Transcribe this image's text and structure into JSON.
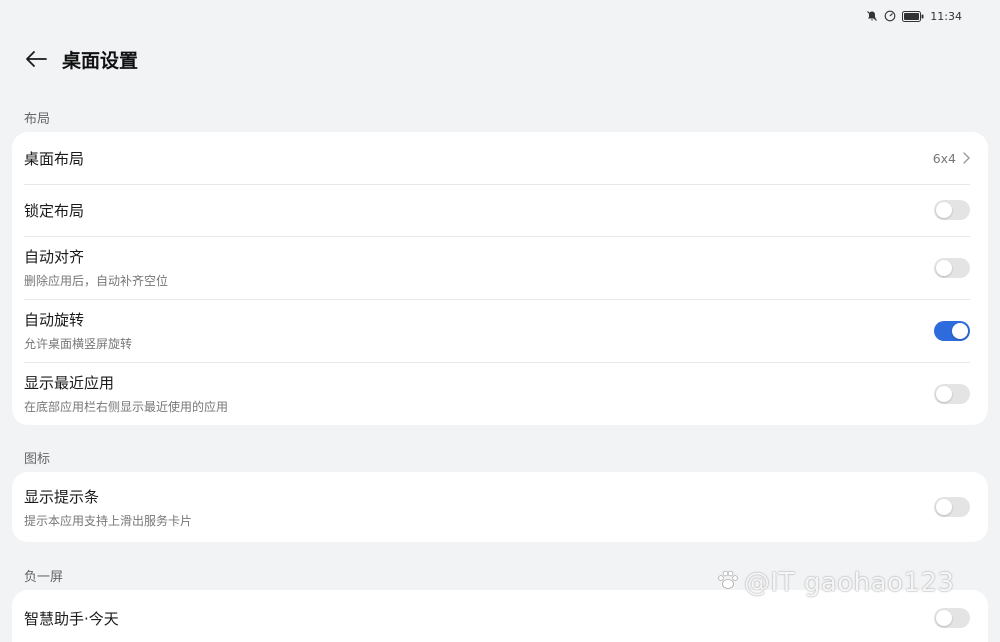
{
  "status_bar": {
    "time": "11:34",
    "icons": [
      "bell-muted-icon",
      "speed-icon",
      "battery-icon"
    ]
  },
  "header": {
    "back_icon": "arrow-left-icon",
    "title": "桌面设置"
  },
  "sections": {
    "layout": {
      "label": "布局",
      "items": {
        "desktop_layout": {
          "title": "桌面布局",
          "value": "6x4"
        },
        "lock_layout": {
          "title": "锁定布局",
          "toggle": false
        },
        "auto_align": {
          "title": "自动对齐",
          "subtitle": "删除应用后，自动补齐空位",
          "toggle": false
        },
        "auto_rotate": {
          "title": "自动旋转",
          "subtitle": "允许桌面横竖屏旋转",
          "toggle": true
        },
        "recent_apps": {
          "title": "显示最近应用",
          "subtitle": "在底部应用栏右侧显示最近使用的应用",
          "toggle": false
        }
      }
    },
    "icons": {
      "label": "图标",
      "items": {
        "hint_bar": {
          "title": "显示提示条",
          "subtitle": "提示本应用支持上滑出服务卡片",
          "toggle": false
        }
      }
    },
    "minus_one": {
      "label": "负一屏",
      "items": {
        "assistant": {
          "title": "智慧助手·今天",
          "toggle": false
        }
      }
    }
  },
  "colors": {
    "accent": "#2e6bdc",
    "background": "#f1f3f5"
  },
  "watermark": {
    "text": "@IT gaohao123"
  }
}
